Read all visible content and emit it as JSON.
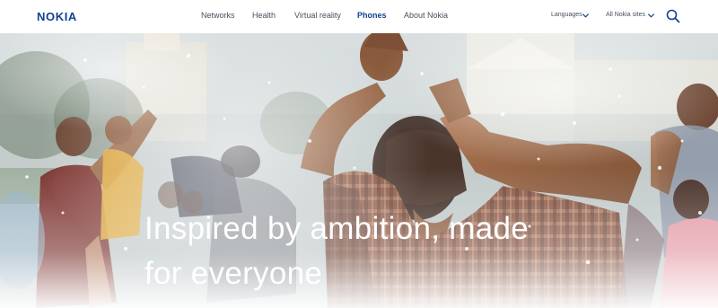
{
  "brand": {
    "logo_text": "NOKIA",
    "color": "#124191"
  },
  "nav": {
    "items": [
      {
        "label": "Networks",
        "active": false
      },
      {
        "label": "Health",
        "active": false
      },
      {
        "label": "Virtual reality",
        "active": false
      },
      {
        "label": "Phones",
        "active": true
      },
      {
        "label": "About Nokia",
        "active": false
      }
    ]
  },
  "utilities": {
    "languages_label": "Languages",
    "sites_label": "All Nokia sites",
    "search_icon": "search-icon",
    "dropdown_icon": "chevron-down-icon"
  },
  "hero": {
    "headline_line1": "Inspired by ambition, made",
    "headline_line2": "for everyone",
    "image": "people-celebrating-water-festival-photo"
  },
  "colors": {
    "nav_text": "#4a4f5c",
    "nav_active": "#124191",
    "headline": "#ffffff"
  }
}
